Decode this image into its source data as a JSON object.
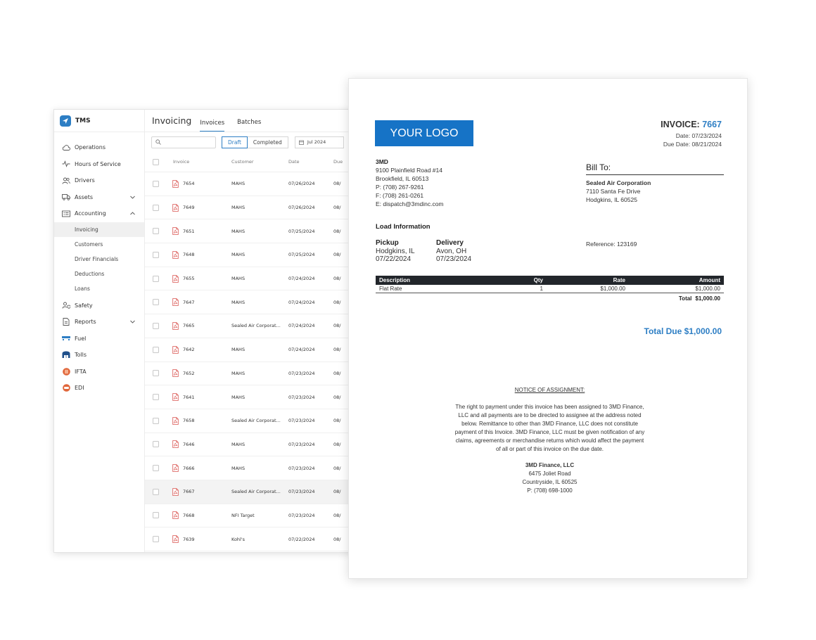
{
  "app": {
    "brand": "TMS",
    "sidebar": {
      "items": [
        {
          "label": "Operations",
          "icon": "cloud-icon"
        },
        {
          "label": "Hours of Service",
          "icon": "pulse-icon"
        },
        {
          "label": "Drivers",
          "icon": "users-icon"
        },
        {
          "label": "Assets",
          "icon": "truck-icon",
          "expandable": true
        },
        {
          "label": "Accounting",
          "icon": "ledger-icon",
          "expanded": true
        },
        {
          "label": "Safety",
          "icon": "user-shield-icon"
        },
        {
          "label": "Reports",
          "icon": "document-icon",
          "expandable": true
        },
        {
          "label": "Fuel",
          "icon": "fuel-icon"
        },
        {
          "label": "Tolls",
          "icon": "tolls-icon"
        },
        {
          "label": "IFTA",
          "icon": "ifta-icon"
        },
        {
          "label": "EDI",
          "icon": "edi-icon"
        }
      ],
      "accounting_sub": [
        "Invoicing",
        "Customers",
        "Driver Financials",
        "Deductions",
        "Loans"
      ],
      "active_sub": "Invoicing"
    },
    "header": {
      "title": "Invoicing",
      "tabs": [
        "Invoices",
        "Batches"
      ],
      "active_tab": "Invoices"
    },
    "filters": {
      "search_placeholder": "",
      "status_options": [
        "Draft",
        "Completed"
      ],
      "status_selected": "Draft",
      "period": "Jul 2024"
    },
    "table": {
      "columns": [
        "Invoice",
        "Customer",
        "Date",
        "Due"
      ],
      "rows": [
        {
          "invoice": "7654",
          "customer": "MAHS",
          "date": "07/26/2024",
          "due": "08/"
        },
        {
          "invoice": "7649",
          "customer": "MAHS",
          "date": "07/26/2024",
          "due": "08/"
        },
        {
          "invoice": "7651",
          "customer": "MAHS",
          "date": "07/25/2024",
          "due": "08/"
        },
        {
          "invoice": "7648",
          "customer": "MAHS",
          "date": "07/25/2024",
          "due": "08/"
        },
        {
          "invoice": "7655",
          "customer": "MAHS",
          "date": "07/24/2024",
          "due": "08/"
        },
        {
          "invoice": "7647",
          "customer": "MAHS",
          "date": "07/24/2024",
          "due": "08/"
        },
        {
          "invoice": "7665",
          "customer": "Sealed Air Corporat...",
          "date": "07/24/2024",
          "due": "08/"
        },
        {
          "invoice": "7642",
          "customer": "MAHS",
          "date": "07/24/2024",
          "due": "08/"
        },
        {
          "invoice": "7652",
          "customer": "MAHS",
          "date": "07/23/2024",
          "due": "08/"
        },
        {
          "invoice": "7641",
          "customer": "MAHS",
          "date": "07/23/2024",
          "due": "08/"
        },
        {
          "invoice": "7658",
          "customer": "Sealed Air Corporat...",
          "date": "07/23/2024",
          "due": "08/"
        },
        {
          "invoice": "7646",
          "customer": "MAHS",
          "date": "07/23/2024",
          "due": "08/"
        },
        {
          "invoice": "7666",
          "customer": "MAHS",
          "date": "07/23/2024",
          "due": "08/"
        },
        {
          "invoice": "7667",
          "customer": "Sealed Air Corporat...",
          "date": "07/23/2024",
          "due": "08/",
          "highlighted": true
        },
        {
          "invoice": "7668",
          "customer": "NFI Target",
          "date": "07/23/2024",
          "due": "08/"
        },
        {
          "invoice": "7639",
          "customer": "Kohl's",
          "date": "07/22/2024",
          "due": "08/"
        }
      ]
    }
  },
  "invoice": {
    "logo_text": "YOUR LOGO",
    "title_label": "INVOICE:",
    "number": "7667",
    "date_line": "Date: 07/23/2024",
    "due_line": "Due Date: 08/21/2024",
    "from": {
      "name": "3MD",
      "lines": [
        "9100 Plainfield Road #14",
        "Brookfield, IL 60513",
        "P: (708) 267-9261",
        "F: (708) 261-0261",
        "E: dispatch@3mdinc.com"
      ]
    },
    "bill_to": {
      "heading": "Bill To:",
      "name": "Sealed Air Corporation",
      "lines": [
        "7110 Santa Fe Drive",
        "Hodgkins, IL 60525"
      ]
    },
    "load_heading": "Load Information",
    "pickup": {
      "heading": "Pickup",
      "city": "Hodgkins, IL",
      "date": "07/22/2024"
    },
    "delivery": {
      "heading": "Delivery",
      "city": "Avon, OH",
      "date": "07/23/2024"
    },
    "reference": "Reference: 123169",
    "lines_table": {
      "headers": [
        "Description",
        "Qty",
        "Rate",
        "Amount"
      ],
      "rows": [
        {
          "description": "Flat Rate",
          "qty": "1",
          "rate": "$1,000.00",
          "amount": "$1,000.00"
        }
      ],
      "total_label": "Total",
      "total_value": "$1,000.00"
    },
    "total_due": "Total Due $1,000.00",
    "notice": {
      "heading": "NOTICE OF ASSIGNMENT:",
      "body": "The right to payment under this invoice has been assigned to 3MD Finance, LLC and all payments are to be directed to assignee at the address noted below. Remittance to other than 3MD Finance, LLC does not constitute payment of this Invoice. 3MD Finance, LLC must be given notification of any claims, agreements or merchandise returns which would affect the payment of all or part of this invoice on the due date.",
      "company": "3MD Finance, LLC",
      "lines": [
        "6475 Joliet Road",
        "Countryside, IL 60525",
        "P: (708) 698-1000"
      ]
    }
  },
  "colors": {
    "accent": "#2d7ec4",
    "logo_bg": "#1673c6",
    "pdf_icon": "#d9534f",
    "table_header": "#22262b"
  }
}
